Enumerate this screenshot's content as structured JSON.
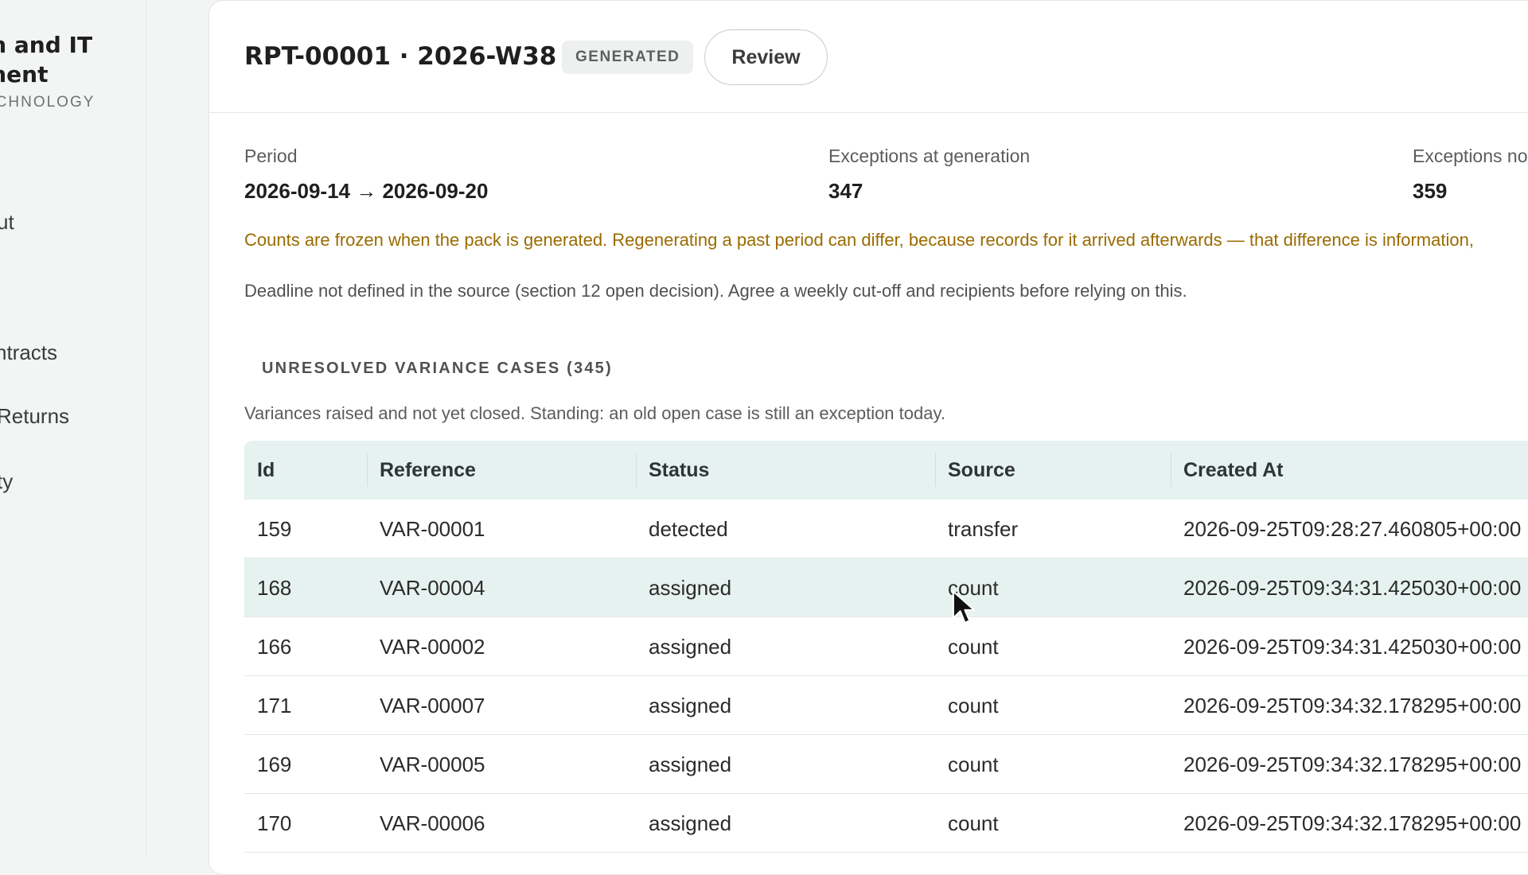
{
  "sidebar": {
    "brand_line1": "em and IT",
    "brand_line2": "ement",
    "brand_sub": "ECHNOLOGY",
    "items": [
      {
        "label": "ut"
      },
      {
        "label": "ntracts"
      },
      {
        "label": "Returns"
      },
      {
        "label": "ty"
      }
    ]
  },
  "report": {
    "title": "RPT-00001 · 2026-W38",
    "status": "GENERATED",
    "review_label": "Review"
  },
  "stats": [
    {
      "label": "Period",
      "value": "2026-09-14 → 2026-09-20"
    },
    {
      "label": "Exceptions at generation",
      "value": "347"
    },
    {
      "label": "Exceptions no",
      "value": "359"
    }
  ],
  "notice": "Counts are frozen when the pack is generated. Regenerating a past period can differ, because records for it arrived afterwards — that difference is information,",
  "deadline": "Deadline not defined in the source (section 12 open decision). Agree a weekly cut-off and recipients before relying on this.",
  "section": {
    "title": "UNRESOLVED VARIANCE CASES (345)",
    "description": "Variances raised and not yet closed. Standing: an old open case is still an exception today."
  },
  "table": {
    "columns": [
      "Id",
      "Reference",
      "Status",
      "Source",
      "Created At"
    ],
    "rows": [
      [
        "159",
        "VAR-00001",
        "detected",
        "transfer",
        "2026-09-25T09:28:27.460805+00:00"
      ],
      [
        "168",
        "VAR-00004",
        "assigned",
        "count",
        "2026-09-25T09:34:31.425030+00:00"
      ],
      [
        "166",
        "VAR-00002",
        "assigned",
        "count",
        "2026-09-25T09:34:31.425030+00:00"
      ],
      [
        "171",
        "VAR-00007",
        "assigned",
        "count",
        "2026-09-25T09:34:32.178295+00:00"
      ],
      [
        "169",
        "VAR-00005",
        "assigned",
        "count",
        "2026-09-25T09:34:32.178295+00:00"
      ],
      [
        "170",
        "VAR-00006",
        "assigned",
        "count",
        "2026-09-25T09:34:32.178295+00:00"
      ]
    ]
  },
  "colors": {
    "accent_row": "#e6f2ef",
    "notice": "#9a6b00"
  }
}
